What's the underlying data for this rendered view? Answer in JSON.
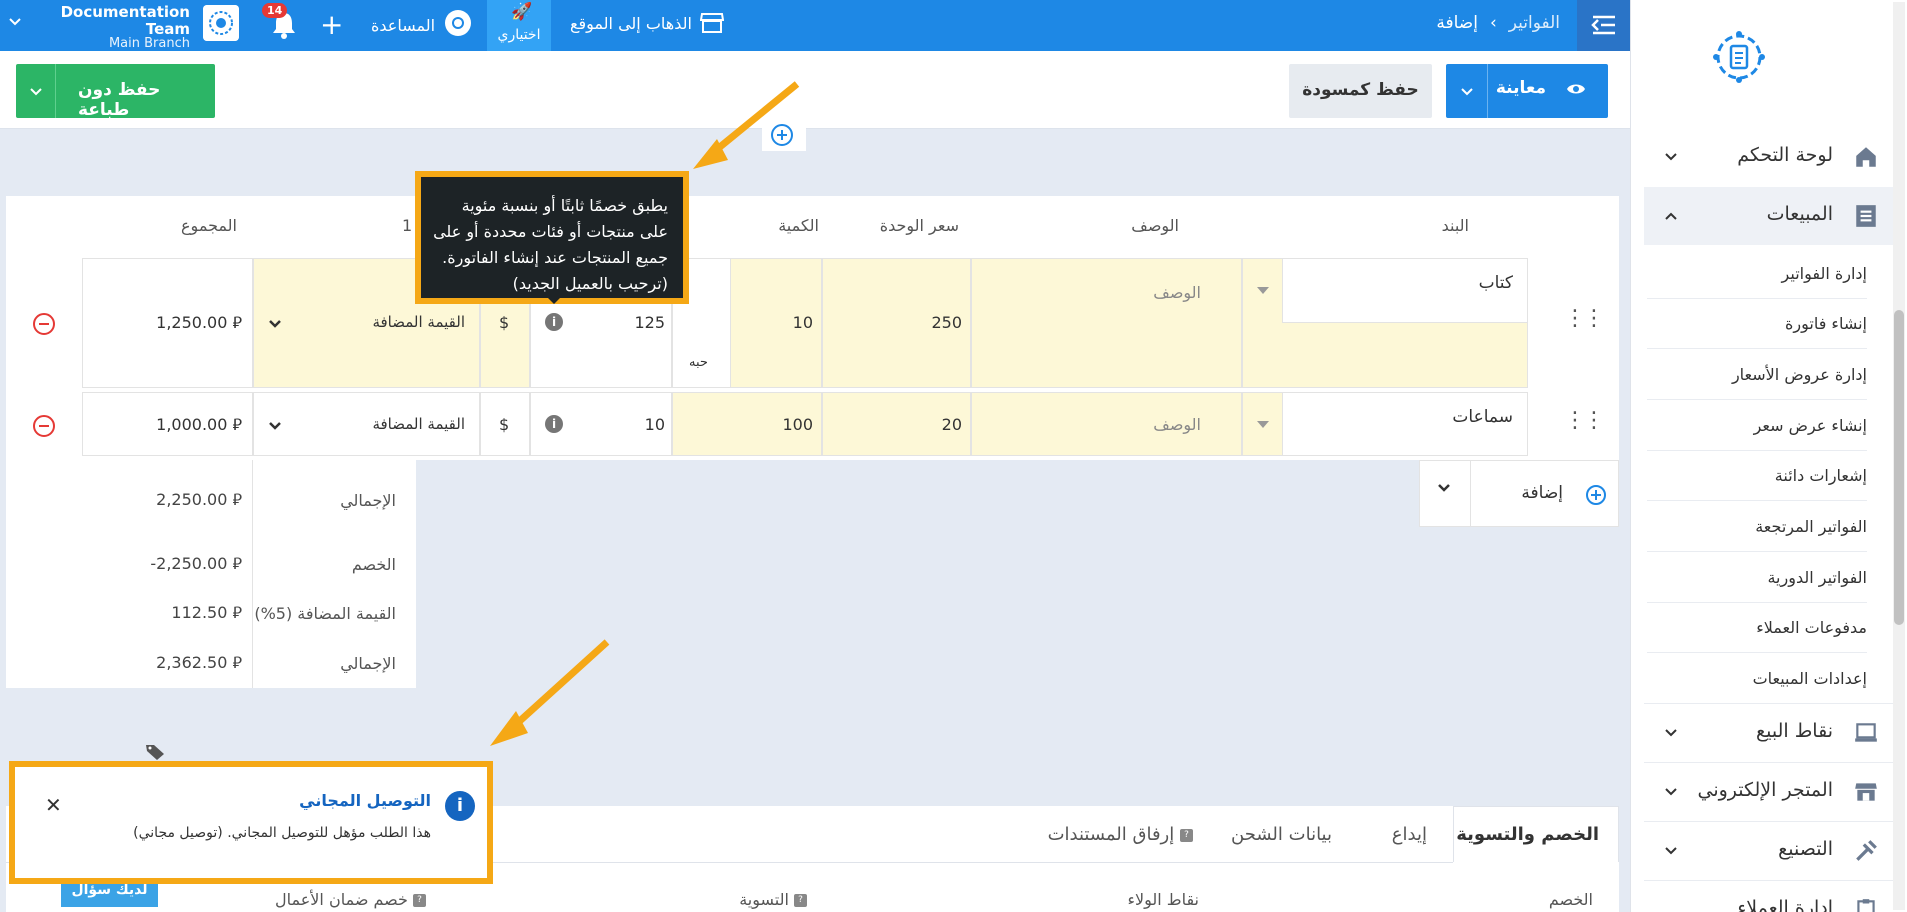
{
  "topbar": {
    "breadcrumb_parent": "الفواتير",
    "breadcrumb_current": "إضافة",
    "visit_site": "الذهاب إلى الموقع",
    "optional": "اختياري",
    "help": "المساعدة",
    "notifications_count": "14",
    "team_name": "Documentation Team",
    "branch_name": "Main Branch",
    "accent": "#1e88e5"
  },
  "actions": {
    "preview": "معاينة",
    "save_draft": "حفظ كمسودة",
    "save_no_print": "حفظ دون طباعة"
  },
  "table": {
    "headers": {
      "item": "البند",
      "description": "الوصف",
      "unit_price": "سعر الوحدة",
      "quantity": "الكمية",
      "discount": "1",
      "total": "المجموع"
    },
    "rows": [
      {
        "item": "كتاب",
        "description_placeholder": "الوصف",
        "unit_price": "250",
        "quantity": "10",
        "unit": "حبه",
        "discount": "125",
        "discount_type": "$",
        "tax": "القيمة المضافة",
        "total": "1,250.00 ⃁"
      },
      {
        "item": "سماعات",
        "description_placeholder": "الوصف",
        "unit_price": "20",
        "quantity": "100",
        "discount": "10",
        "discount_type": "$",
        "tax": "القيمة المضافة",
        "total": "1,000.00 ⃁"
      }
    ],
    "add_label": "إضافة"
  },
  "totals": [
    {
      "label": "الإجمالي",
      "value": "2,250.00 ⃁"
    },
    {
      "label": "الخصم",
      "value": "-2,250.00 ⃁"
    },
    {
      "label": "القيمة المضافة (5%)",
      "value": "112.50 ⃁"
    },
    {
      "label": "الإجمالي",
      "value": "2,362.50 ⃁"
    }
  ],
  "tooltip": {
    "text": "يطبق خصمًا ثابتًا أو بنسبة مئوية على منتجات أو فئات محددة أو على جميع المنتجات عند إنشاء الفاتورة. (ترحيب بالعميل الجديد)"
  },
  "notification": {
    "title": "التوصيل المجاني",
    "body": "هذا الطلب مؤهل للتوصيل المجاني. (توصيل مجاني)"
  },
  "tabs": [
    "الخصم والتسوية",
    "إيداع",
    "بيانات الشحن",
    "إرفاق المستندات"
  ],
  "fields": {
    "discount": "الخصم",
    "loyalty_points": "نقاط الولاء",
    "settlement": "التسوية",
    "retention": "خصم ضمان الأعمال"
  },
  "ask_button": "لديك سؤال",
  "sidebar": {
    "dashboard": "لوحة التحكم",
    "sales": "المبيعات",
    "sales_items": [
      "إدارة الفواتير",
      "إنشاء فاتورة",
      "إدارة عروض الأسعار",
      "إنشاء عرض سعر",
      "إشعارات دائنة",
      "الفواتير المرتجعة",
      "الفواتير الدورية",
      "مدفوعات العملاء",
      "إعدادات المبيعات"
    ],
    "pos": "نقاط البيع",
    "store": "المتجر الإلكتروني",
    "manufacturing": "التصنيع",
    "last": "إدارة العملاء"
  }
}
